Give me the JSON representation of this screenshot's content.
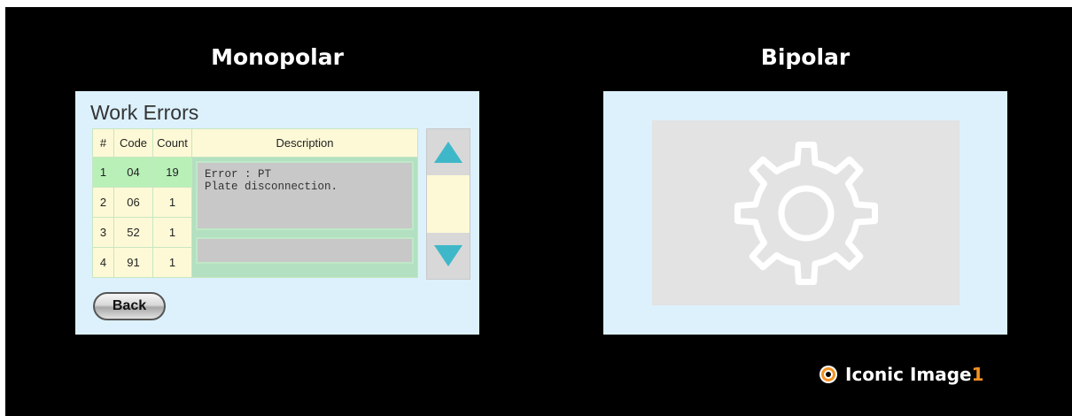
{
  "headings": {
    "monopolar": "Monopolar",
    "bipolar": "Bipolar"
  },
  "work_errors": {
    "title": "Work Errors",
    "columns": [
      "#",
      "Code",
      "Count",
      "Description"
    ],
    "rows": [
      {
        "num": "1",
        "code": "04",
        "count": "19"
      },
      {
        "num": "2",
        "code": "06",
        "count": "1"
      },
      {
        "num": "3",
        "code": "52",
        "count": "1"
      },
      {
        "num": "4",
        "code": "91",
        "count": "1"
      }
    ],
    "selected_row": 1,
    "description_line1": "Error : PT",
    "description_line2": "Plate disconnection.",
    "back_label": "Back"
  },
  "icons": {
    "scroll_up": "triangle-up-icon",
    "scroll_down": "triangle-down-icon",
    "bipolar_placeholder": "gear-icon",
    "brand_logo": "power-ring-icon"
  },
  "colors": {
    "panel_bg": "#dcf1fc",
    "header_bg": "#fdf9d6",
    "selected_row": "#b8f0b8",
    "arrow": "#3eb8c8",
    "brand_accent": "#f39222"
  },
  "brand": {
    "text": "Iconic Image",
    "accent": "1"
  }
}
